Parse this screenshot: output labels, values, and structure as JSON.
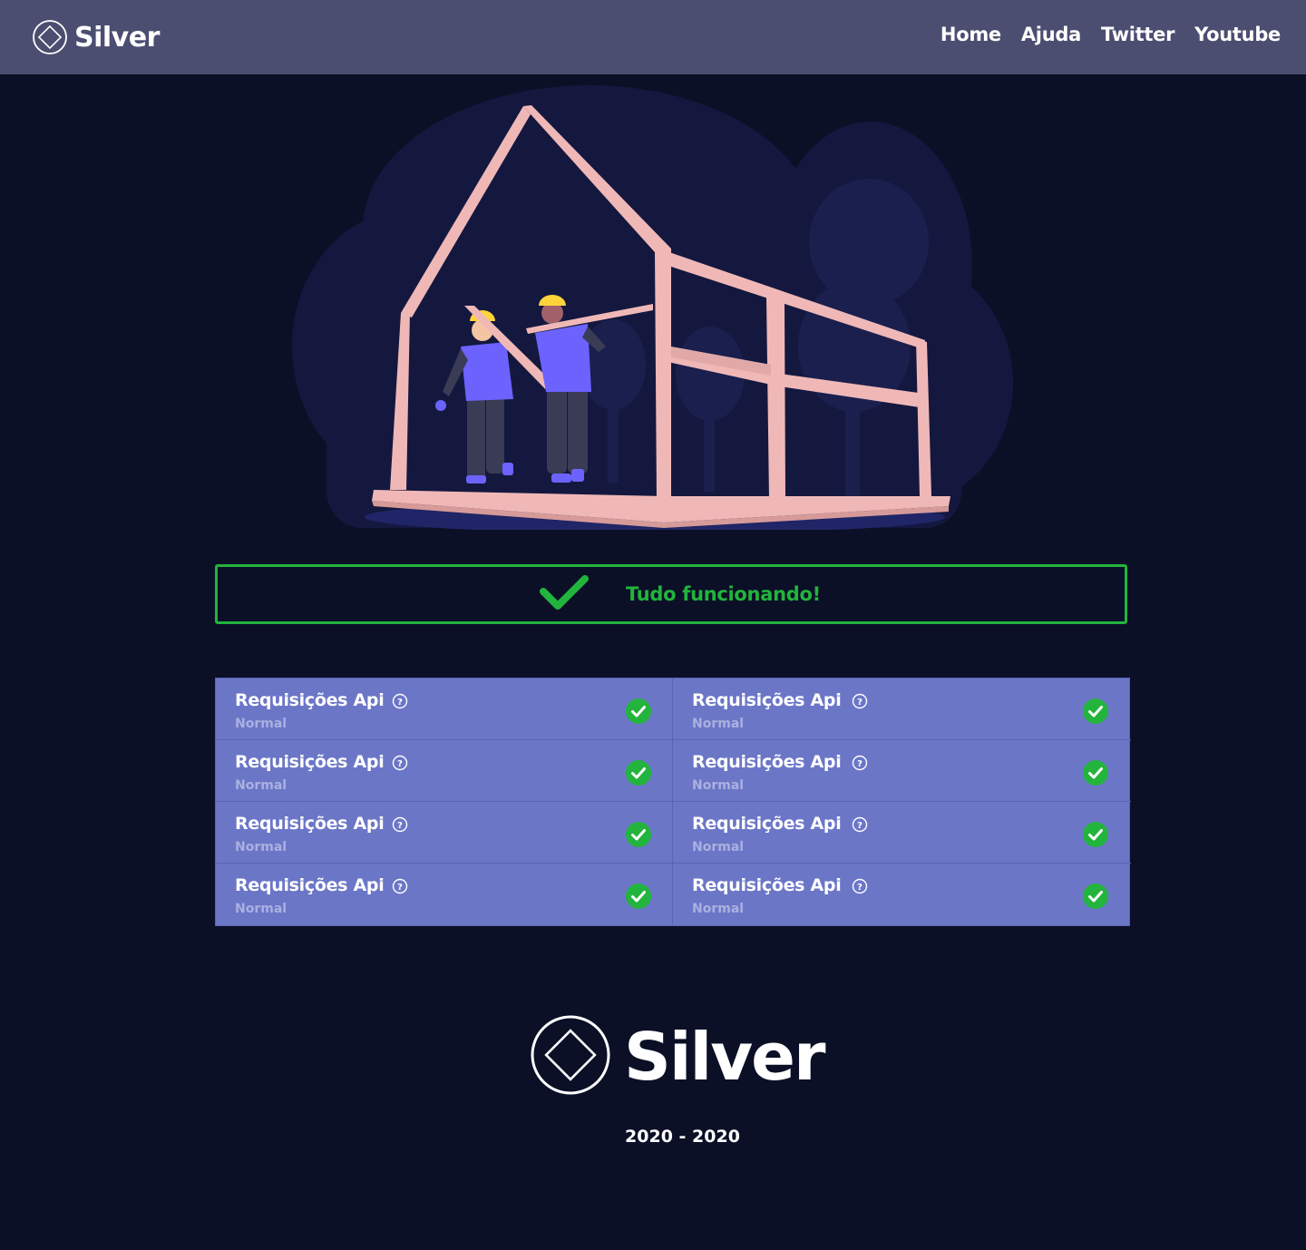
{
  "brand": {
    "name": "Silver",
    "logo_icon": "diamond-circle-logo"
  },
  "nav": {
    "links": [
      "Home",
      "Ajuda",
      "Twitter",
      "Youtube"
    ]
  },
  "hero": {
    "illustration": "workers-building-house-frame"
  },
  "status": {
    "icon": "checkmark-icon",
    "message": "Tudo funcionando!",
    "color": "#22b43c"
  },
  "services": [
    {
      "name": "Requisições Api",
      "status": "Normal"
    },
    {
      "name": "Requisições Api",
      "status": "Normal"
    },
    {
      "name": "Requisições Api",
      "status": "Normal"
    },
    {
      "name": "Requisições Api",
      "status": "Normal"
    },
    {
      "name": "Requisições Api",
      "status": "Normal"
    },
    {
      "name": "Requisições Api",
      "status": "Normal"
    },
    {
      "name": "Requisições Api",
      "status": "Normal"
    },
    {
      "name": "Requisições Api",
      "status": "Normal"
    }
  ],
  "footer": {
    "brand": "Silver",
    "years": "2020 - 2020"
  },
  "colors": {
    "background": "#0b1027",
    "navbar": "#4b4e70",
    "panel": "#6b76c7",
    "ok": "#22b43c"
  }
}
